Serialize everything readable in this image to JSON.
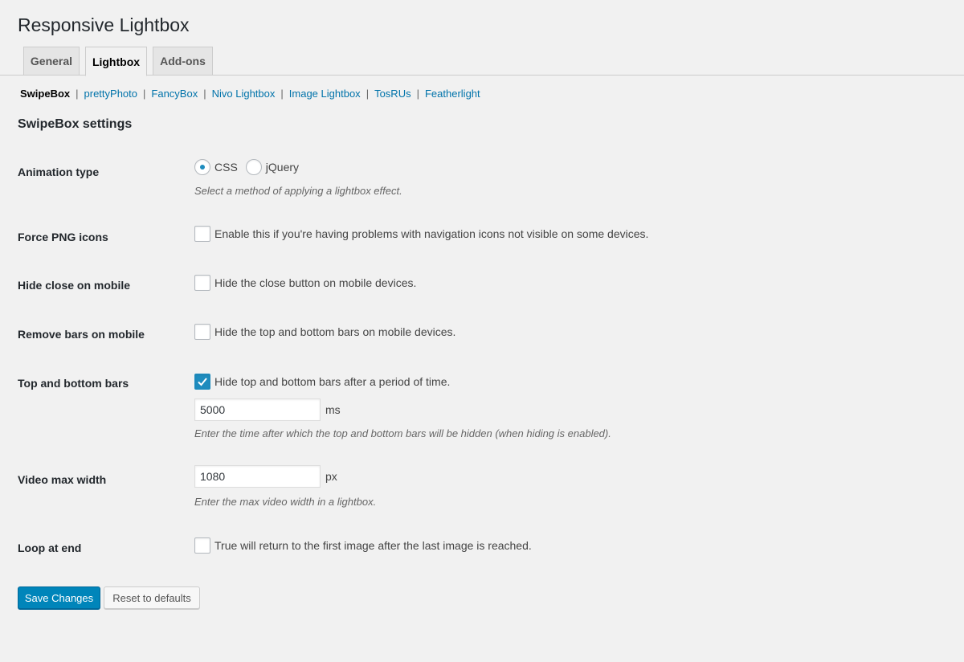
{
  "page": {
    "title": "Responsive Lightbox"
  },
  "tabs": [
    {
      "label": "General",
      "active": false
    },
    {
      "label": "Lightbox",
      "active": true
    },
    {
      "label": "Add-ons",
      "active": false
    }
  ],
  "subnav": {
    "items": [
      "SwipeBox",
      "prettyPhoto",
      "FancyBox",
      "Nivo Lightbox",
      "Image Lightbox",
      "TosRUs",
      "Featherlight"
    ],
    "current": "SwipeBox",
    "separator": "|"
  },
  "section": {
    "title": "SwipeBox settings"
  },
  "settings": {
    "animation_type": {
      "label": "Animation type",
      "options": [
        "CSS",
        "jQuery"
      ],
      "selected": "CSS",
      "description": "Select a method of applying a lightbox effect."
    },
    "force_png": {
      "label": "Force PNG icons",
      "checked": false,
      "text": "Enable this if you're having problems with navigation icons not visible on some devices."
    },
    "hide_close": {
      "label": "Hide close on mobile",
      "checked": false,
      "text": "Hide the close button on mobile devices."
    },
    "remove_bars": {
      "label": "Remove bars on mobile",
      "checked": false,
      "text": "Hide the top and bottom bars on mobile devices."
    },
    "top_bottom_bars": {
      "label": "Top and bottom bars",
      "checked": true,
      "text": "Hide top and bottom bars after a period of time.",
      "value": "5000",
      "unit": "ms",
      "description": "Enter the time after which the top and bottom bars will be hidden (when hiding is enabled)."
    },
    "video_max_width": {
      "label": "Video max width",
      "value": "1080",
      "unit": "px",
      "description": "Enter the max video width in a lightbox."
    },
    "loop_at_end": {
      "label": "Loop at end",
      "checked": false,
      "text": "True will return to the first image after the last image is reached."
    }
  },
  "buttons": {
    "save": "Save Changes",
    "reset": "Reset to defaults"
  },
  "colors": {
    "accent": "#0085ba",
    "link": "#0073aa",
    "check": "#1e8cbe"
  }
}
